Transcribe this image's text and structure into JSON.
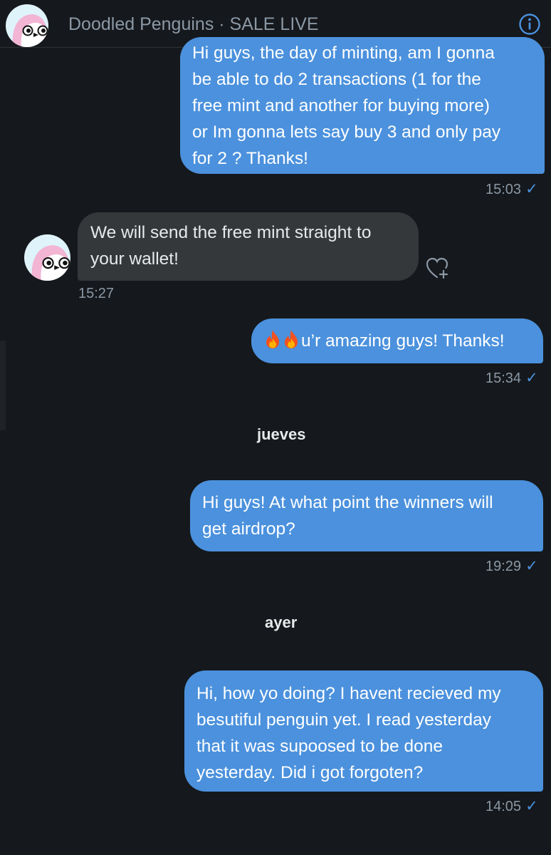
{
  "header": {
    "title": "Doodled Penguins · SALE LIVE",
    "avatar_icon": "penguin-avatar",
    "info_icon": "info-icon"
  },
  "messages": [
    {
      "direction": "sent",
      "lines": [
        "Hi guys, the day of minting, am I gonna",
        "be able to do 2 transactions (1 for the",
        "free mint and another for buying more)",
        "or Im gonna lets say buy 3 and only pay",
        "for 2 ? Thanks!"
      ],
      "time": "15:03"
    },
    {
      "direction": "received",
      "lines": [
        "We will send the free mint straight to",
        "your wallet!"
      ],
      "time": "15:27"
    },
    {
      "direction": "sent",
      "emoji": "🔥🔥",
      "lines": [
        "u’r amazing guys! Thanks!"
      ],
      "time": "15:34"
    },
    {
      "direction": "sent",
      "lines": [
        "Hi guys! At what point the winners will",
        "get airdrop?"
      ],
      "time": "19:29"
    },
    {
      "direction": "sent",
      "lines": [
        "Hi, how yo doing? I havent recieved my",
        "besutiful penguin yet. I read yesterday",
        "that it was supoosed to be done",
        "yesterday. Did i got forgoten?"
      ],
      "time": "14:05"
    }
  ],
  "day_separators": [
    "jueves",
    "ayer"
  ],
  "read_mark": "✓",
  "colors": {
    "background": "#15181c",
    "sent_bubble": "#4b91dd",
    "received_bubble": "#35383b",
    "muted_text": "#8b98a5",
    "accent": "#4b91dd"
  }
}
